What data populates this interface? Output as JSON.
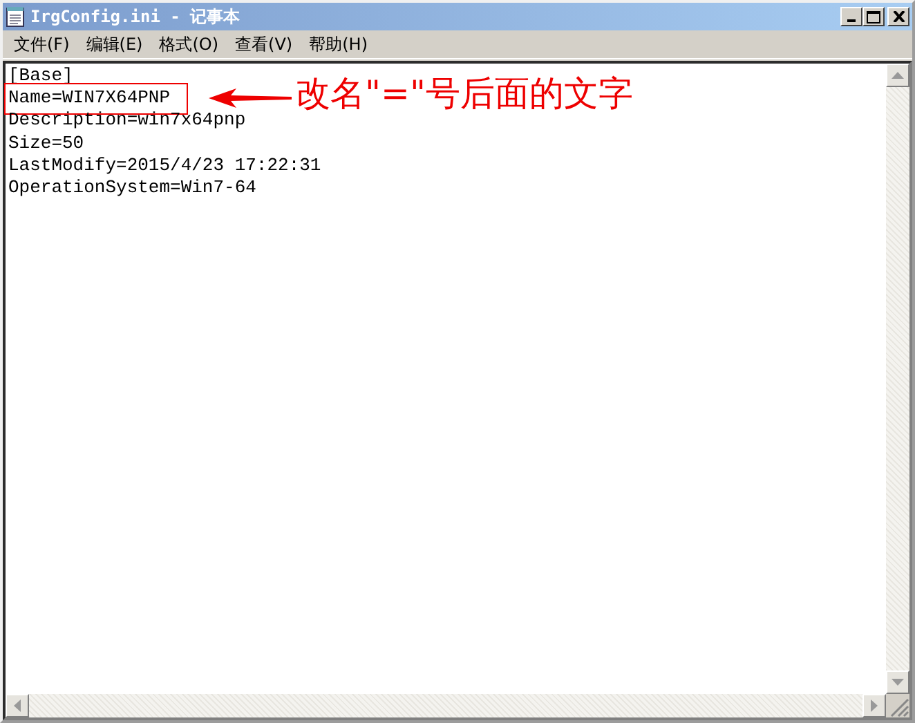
{
  "window": {
    "title": "IrgConfig.ini - 记事本"
  },
  "menu": [
    {
      "label": "文件(F)"
    },
    {
      "label": "编辑(E)"
    },
    {
      "label": "格式(O)"
    },
    {
      "label": "查看(V)"
    },
    {
      "label": "帮助(H)"
    }
  ],
  "lines": [
    {
      "text": "[Base]",
      "highlighted": false
    },
    {
      "text": "Name=WIN7X64PNP",
      "highlighted": true
    },
    {
      "text": "Description=win7x64pnp",
      "highlighted": false
    },
    {
      "text": "Size=50",
      "highlighted": false
    },
    {
      "text": "LastModify=2015/4/23 17:22:31",
      "highlighted": false
    },
    {
      "text": "OperationSystem=Win7-64",
      "highlighted": false
    }
  ],
  "annotation": {
    "text": "改名\"=\"号后面的文字"
  }
}
